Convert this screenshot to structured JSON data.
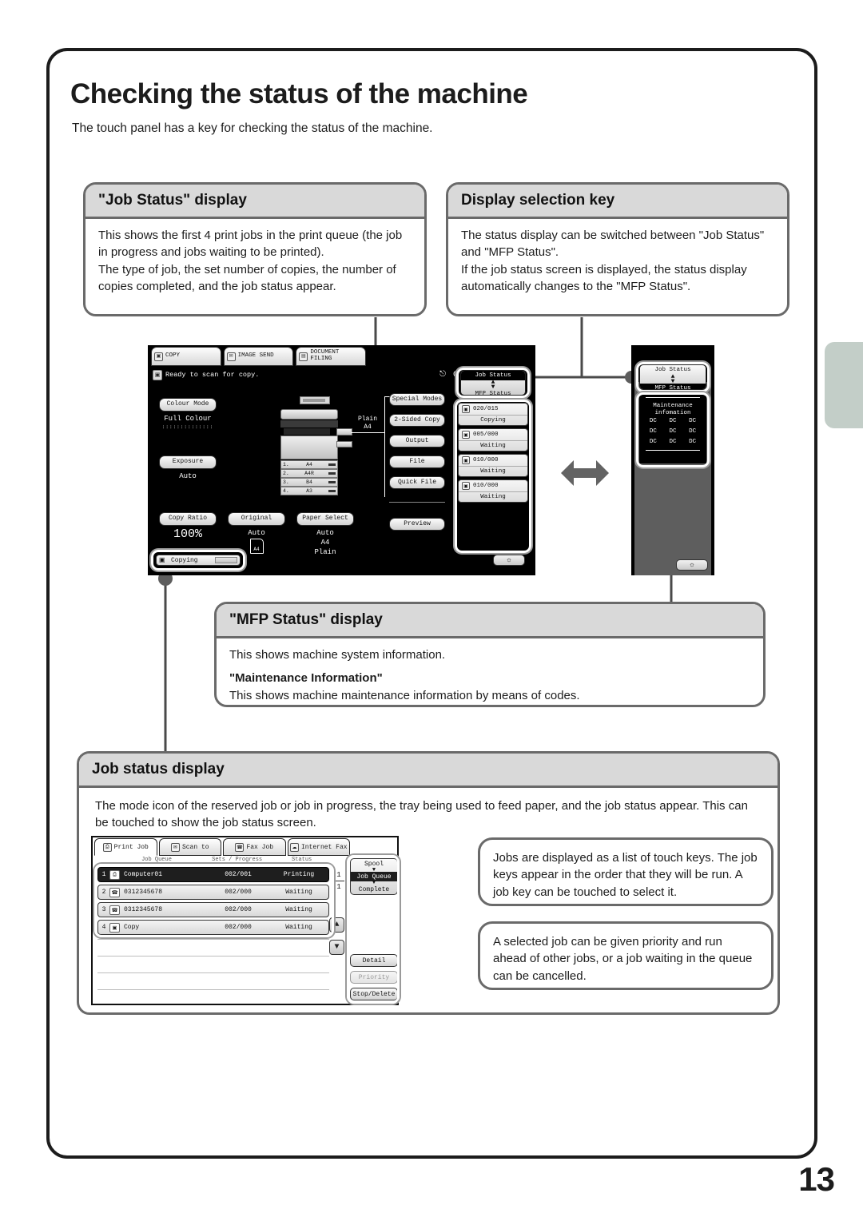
{
  "page": {
    "title": "Checking the status of the machine",
    "intro": "The touch panel has a key for checking the status of the machine.",
    "number": "13"
  },
  "callouts": {
    "job_status": {
      "header": "\"Job Status\" display",
      "body": "This shows the first 4 print jobs in the print queue (the job in progress and jobs waiting to be printed).\nThe type of job, the set number of copies, the number of copies completed, and the job status appear."
    },
    "display_selection": {
      "header": "Display selection key",
      "body": "The status display can be switched between \"Job Status\" and \"MFP Status\".\nIf the job status screen is displayed, the status display automatically changes to the \"MFP Status\"."
    },
    "mfp_status": {
      "header": "\"MFP Status\" display",
      "body": "This shows machine system information.",
      "sub_header": "\"Maintenance Information\"",
      "sub_body": "This shows machine maintenance information by means of codes."
    },
    "job_status_display": {
      "header": "Job status display",
      "body": "The mode icon of the reserved job or job in progress, the tray being used to feed paper, and the job status appear. This can be touched to show the job status screen."
    },
    "touch_keys": {
      "body": "Jobs are displayed as a list of touch keys. The job keys appear in the order that they will be run. A job key can be touched to select it."
    },
    "priority": {
      "body": "A selected job can be given priority and run ahead of other jobs, or a job waiting in the queue can be cancelled."
    }
  },
  "main_panel": {
    "tabs": [
      {
        "label": "COPY",
        "icon": "copy-icon",
        "glyph": "❐"
      },
      {
        "label": "IMAGE SEND",
        "icon": "image-send-icon",
        "glyph": "✉"
      },
      {
        "label": "DOCUMENT FILING",
        "icon": "document-filing-icon",
        "glyph": "☰"
      }
    ],
    "status_message": "Ready to scan for copy.",
    "top_right_count": "0",
    "top_right_icon": "toner-icon",
    "left_keys": [
      {
        "label": "Colour Mode",
        "value": "Full Colour",
        "dots": "::::::::::::::"
      },
      {
        "label": "Exposure",
        "value": "Auto"
      },
      {
        "label": "Copy Ratio",
        "value": "100%"
      }
    ],
    "bottom_keys": [
      {
        "label": "Original",
        "value": "Auto",
        "icon": "a4-original-icon",
        "icon_label": "A4"
      },
      {
        "label": "Paper Select",
        "value": "Auto",
        "value2": "A4",
        "value3": "Plain"
      }
    ],
    "right_keys": [
      "Special Modes",
      "2-Sided Copy",
      "Output",
      "File",
      "Quick File",
      "Preview"
    ],
    "machine": {
      "paper_callout_type": "Plain",
      "paper_callout_size": "A4",
      "trays": [
        {
          "n": "1.",
          "size": "A4"
        },
        {
          "n": "2.",
          "size": "A4R"
        },
        {
          "n": "3.",
          "size": "B4"
        },
        {
          "n": "4.",
          "size": "A3"
        }
      ]
    },
    "job_status_bar": {
      "label": "Copying",
      "icon": "copy-status-icon"
    },
    "lamp_button": {
      "icon": "brightness-icon",
      "glyph": "☼"
    }
  },
  "status_selector": {
    "top_label": "Job Status",
    "bottom_label": "MFP Status",
    "toggle_icon": "up-down-arrow-icon",
    "selected": "Job Status"
  },
  "job_status_cells": [
    {
      "icon": "print-job-icon",
      "count": "020/015",
      "state": "Copying"
    },
    {
      "icon": "print-job-icon",
      "count": "005/000",
      "state": "Waiting"
    },
    {
      "icon": "print-job-icon",
      "count": "010/000",
      "state": "Waiting"
    },
    {
      "icon": "print-job-icon",
      "count": "010/000",
      "state": "Waiting"
    }
  ],
  "mfp_panel": {
    "selector": {
      "top_label": "Job Status",
      "bottom_label": "MFP Status",
      "toggle_icon": "up-down-arrow-icon",
      "selected": "MFP Status"
    },
    "info_title_line1": "Maintenance",
    "info_title_line2": "infomation",
    "codes": [
      "DC",
      "DC",
      "DC",
      "DC",
      "DC",
      "DC",
      "DC",
      "DC",
      "DC"
    ],
    "lamp_button": {
      "icon": "brightness-icon",
      "glyph": "☼"
    }
  },
  "switch_arrow_icon": "left-right-arrow-icon",
  "job_screen": {
    "tabs": [
      {
        "label": "Print Job",
        "icon": "printer-icon",
        "glyph": "⎙",
        "active": true
      },
      {
        "label": "Scan to",
        "icon": "scan-icon",
        "glyph": "✉",
        "active": false
      },
      {
        "label": "Fax Job",
        "icon": "fax-icon",
        "glyph": "☎",
        "active": false
      },
      {
        "label": "Internet Fax",
        "icon": "internet-fax-icon",
        "glyph": "⌁",
        "active": false
      }
    ],
    "columns": [
      "Job Queue",
      "Sets / Progress",
      "Status"
    ],
    "rows": [
      {
        "index": "1",
        "icon": "computer-job-icon",
        "glyph": "⎙",
        "name": "Computer01",
        "sets": "002/001",
        "status": "Printing",
        "selected": true
      },
      {
        "index": "2",
        "icon": "fax-job-icon",
        "glyph": "☎",
        "name": "0312345678",
        "sets": "002/000",
        "status": "Waiting",
        "selected": false
      },
      {
        "index": "3",
        "icon": "fax-job-icon",
        "glyph": "☎",
        "name": "0312345678",
        "sets": "002/000",
        "status": "Waiting",
        "selected": false
      },
      {
        "index": "4",
        "icon": "copy-job-icon",
        "glyph": "❐",
        "name": "Copy",
        "sets": "002/000",
        "status": "Waiting",
        "selected": false
      }
    ],
    "pager": {
      "current": "1",
      "total": "1"
    },
    "scroll_up_icon": "arrow-up-icon",
    "scroll_down_icon": "arrow-down-icon",
    "view_selector": {
      "spool": "Spool",
      "job_queue": "Job Queue",
      "complete": "Complete",
      "selected": "Job Queue"
    },
    "action_buttons": [
      {
        "label": "Detail",
        "enabled": true
      },
      {
        "label": "Priority",
        "enabled": false
      },
      {
        "label": "Stop/Delete",
        "enabled": true
      }
    ]
  }
}
